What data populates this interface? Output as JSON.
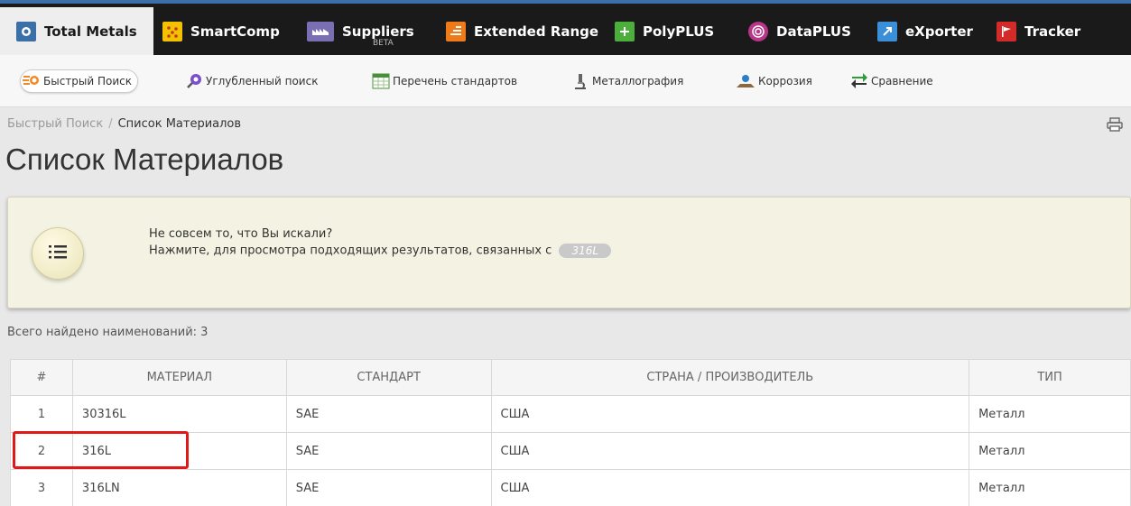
{
  "products": [
    {
      "label": "Total Metals",
      "icon": "total-metals-icon",
      "color": "#3b6fa8",
      "active": true
    },
    {
      "label": "SmartComp",
      "icon": "smartcomp-icon",
      "color": "#f2c200"
    },
    {
      "label": "Suppliers",
      "badge": "BETA",
      "icon": "suppliers-icon",
      "color": "#7a6fb2"
    },
    {
      "label": "Extended Range",
      "icon": "extended-range-icon",
      "color": "#f07a17"
    },
    {
      "label": "PolyPLUS",
      "icon": "polyplus-icon",
      "color": "#4caf3c"
    },
    {
      "label": "DataPLUS",
      "icon": "dataplus-icon",
      "color": "#b8368a"
    },
    {
      "label": "eXporter",
      "icon": "exporter-icon",
      "color": "#3b8fd9"
    },
    {
      "label": "Tracker",
      "icon": "tracker-icon",
      "color": "#d32a2a"
    }
  ],
  "toolbar": [
    {
      "label": "Быстрый Поиск",
      "icon": "quick-search-icon",
      "active": true
    },
    {
      "label": "Углубленный поиск",
      "icon": "advanced-search-icon"
    },
    {
      "label": "Перечень стандартов",
      "icon": "standards-list-icon"
    },
    {
      "label": "Металлография",
      "icon": "microscope-icon"
    },
    {
      "label": "Коррозия",
      "icon": "corrosion-icon"
    },
    {
      "label": "Сравнение",
      "icon": "compare-arrows-icon"
    }
  ],
  "breadcrumb": {
    "root": "Быстрый Поиск",
    "separator": "/",
    "current": "Список Материалов"
  },
  "page_title": "Список Материалов",
  "notice": {
    "line1": "Не совсем то, что Вы искали?",
    "line2": "Нажмите, для просмотра подходящих результатов, связанных с",
    "term": "316L"
  },
  "found_text": "Всего найдено наименований: 3",
  "table": {
    "headers": [
      "#",
      "МАТЕРИАЛ",
      "СТАНДАРТ",
      "СТРАНА / ПРОИЗВОДИТЕЛЬ",
      "ТИП"
    ],
    "rows": [
      [
        "1",
        "30316L",
        "SAE",
        "США",
        "Металл"
      ],
      [
        "2",
        "316L",
        "SAE",
        "США",
        "Металл"
      ],
      [
        "3",
        "316LN",
        "SAE",
        "США",
        "Металл"
      ]
    ]
  },
  "colors": {
    "highlight": "#e01818",
    "accent": "#3b6fa8"
  }
}
